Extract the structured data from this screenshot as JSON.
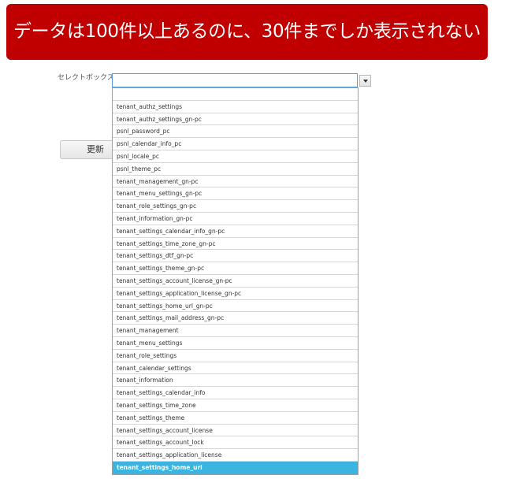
{
  "banner": {
    "text": "データは100件以上あるのに、30件までしか表示されない"
  },
  "form": {
    "select_label": "セレクトボックス",
    "select_value": "",
    "update_button_label": "更新"
  },
  "dropdown": {
    "items": [
      "",
      "tenant_authz_settings",
      "tenant_authz_settings_gn-pc",
      "psnl_password_pc",
      "psnl_calendar_info_pc",
      "psnl_locale_pc",
      "psnl_theme_pc",
      "tenant_management_gn-pc",
      "tenant_menu_settings_gn-pc",
      "tenant_role_settings_gn-pc",
      "tenant_information_gn-pc",
      "tenant_settings_calendar_info_gn-pc",
      "tenant_settings_time_zone_gn-pc",
      "tenant_settings_dtf_gn-pc",
      "tenant_settings_theme_gn-pc",
      "tenant_settings_account_license_gn-pc",
      "tenant_settings_application_license_gn-pc",
      "tenant_settings_home_url_gn-pc",
      "tenant_settings_mail_address_gn-pc",
      "tenant_management",
      "tenant_menu_settings",
      "tenant_role_settings",
      "tenant_calendar_settings",
      "tenant_information",
      "tenant_settings_calendar_info",
      "tenant_settings_time_zone",
      "tenant_settings_theme",
      "tenant_settings_account_license",
      "tenant_settings_account_lock",
      "tenant_settings_application_license",
      "tenant_settings_home_url"
    ],
    "highlighted": "tenant_settings_home_url"
  },
  "colors": {
    "banner_bg": "#c00000",
    "highlight_bg": "#3bb4e0",
    "focus_border": "#5b9bd5"
  }
}
